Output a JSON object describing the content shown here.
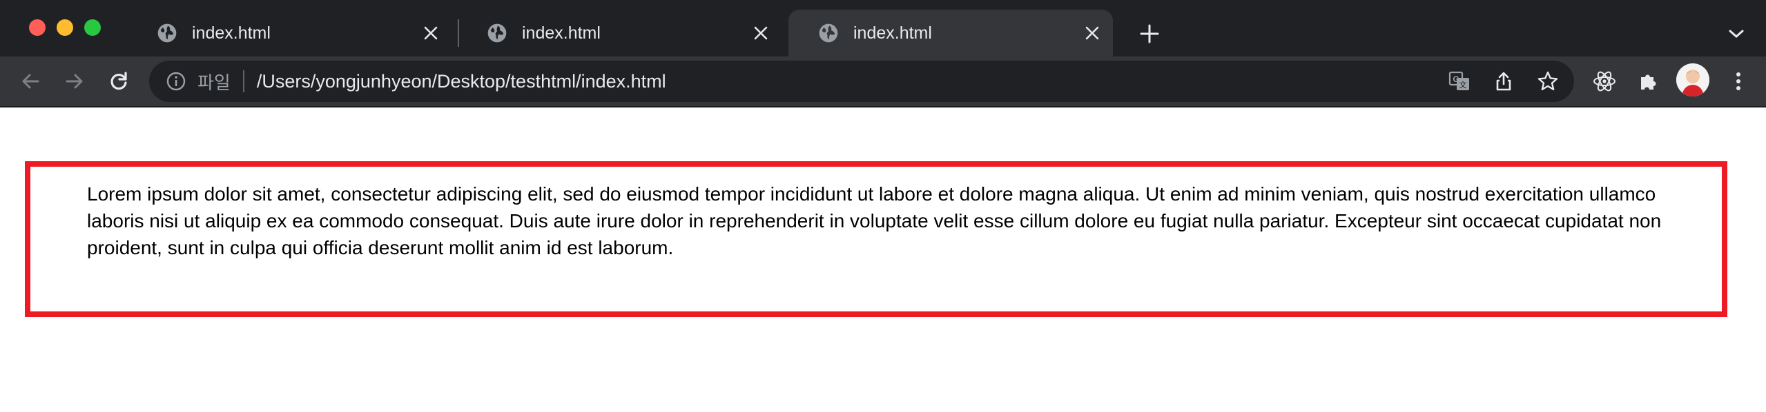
{
  "window": {
    "traffic_lights": {
      "close_color": "#ff5f57",
      "minimize_color": "#febc2e",
      "zoom_color": "#28c840"
    }
  },
  "tabs": [
    {
      "title": "index.html",
      "icon": "globe-icon",
      "active": false
    },
    {
      "title": "index.html",
      "icon": "globe-icon",
      "active": false
    },
    {
      "title": "index.html",
      "icon": "globe-icon",
      "active": true
    }
  ],
  "toolbar": {
    "back_icon": "arrow-left-icon",
    "forward_icon": "arrow-right-icon",
    "reload_icon": "reload-icon",
    "address": {
      "scheme_label": "파일",
      "url": "/Users/yongjunhyeon/Desktop/testhtml/index.html"
    },
    "actions": [
      "translate-icon",
      "share-icon",
      "bookmark-star-icon"
    ],
    "extensions": [
      "react-devtools-icon",
      "extensions-puzzle-icon"
    ],
    "menu_icon": "kebab-menu-icon"
  },
  "page": {
    "paragraph": "Lorem ipsum dolor sit amet, consectetur adipiscing elit, sed do eiusmod tempor incididunt ut labore et dolore magna aliqua. Ut enim ad minim veniam, quis nostrud exercitation ullamco laboris nisi ut aliquip ex ea commodo consequat. Duis aute irure dolor in reprehenderit in voluptate velit esse cillum dolore eu fugiat nulla pariatur. Excepteur sint occaecat cupidatat non proident, sunt in culpa qui officia deserunt mollit anim id est laborum.",
    "border_color": "#ee1b24"
  }
}
